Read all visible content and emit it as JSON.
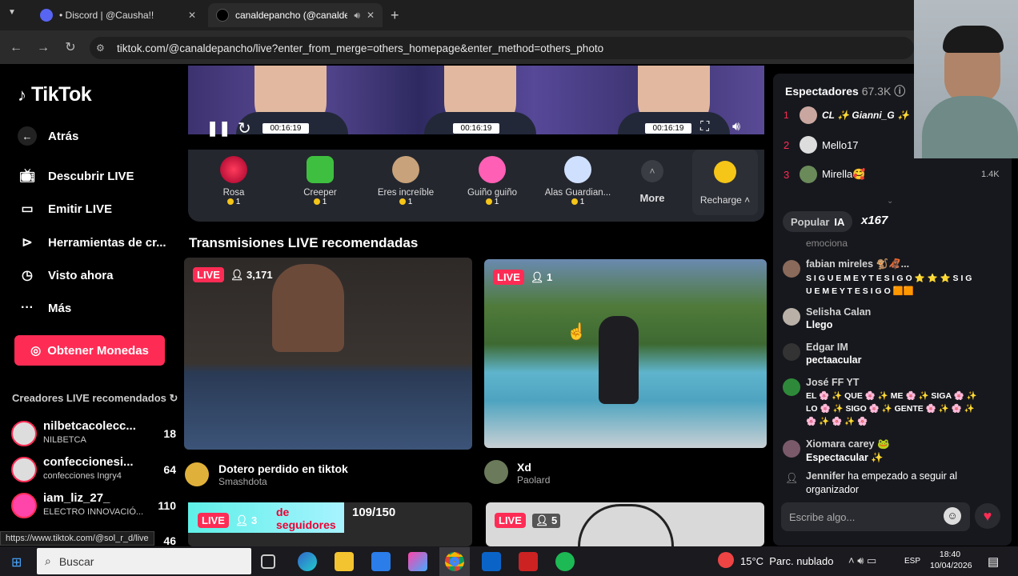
{
  "browser": {
    "tabs": [
      {
        "label": "• Discord | @Causha!!"
      },
      {
        "label": "canaldepancho (@canaldep"
      }
    ],
    "url": "tiktok.com/@canaldepancho/live?enter_from_merge=others_homepage&enter_method=others_photo"
  },
  "sidebar": {
    "logo": "TikTok",
    "back": "Atrás",
    "nav": [
      "Descubrir LIVE",
      "Emitir LIVE",
      "Herramientas de cr...",
      "Visto ahora",
      "Más"
    ],
    "coins_button": "Obtener Monedas",
    "creators_title": "Creadores LIVE recomendados",
    "creators": [
      {
        "name": "nilbetcacolecc...",
        "sub": "NILBETCA",
        "count": "18"
      },
      {
        "name": "confeccionesi...",
        "sub": "confecciones Ingry4",
        "count": "64"
      },
      {
        "name": "iam_liz_27_",
        "sub": "ELECTRO INNOVACIÓ...",
        "count": "110"
      },
      {
        "name": "",
        "sub": "",
        "count": "46"
      }
    ],
    "status_url": "https://www.tiktok.com/@sol_r_d/live"
  },
  "player": {
    "times": [
      "00:16:19",
      "00:16:19",
      "00:16:19"
    ]
  },
  "gifts": [
    {
      "name": "Rosa",
      "cost": "1"
    },
    {
      "name": "Creeper",
      "cost": "1"
    },
    {
      "name": "Eres increíble",
      "cost": "1"
    },
    {
      "name": "Guiño guiño",
      "cost": "1"
    },
    {
      "name": "Alas Guardian...",
      "cost": "1"
    }
  ],
  "gift_more": "More",
  "recharge": "Recharge",
  "recommended_title": "Transmisiones LIVE recomendadas",
  "streams": [
    {
      "badge": "LIVE",
      "viewers": "3,171",
      "title": "Dotero perdido en tiktok",
      "user": "Smashdota"
    },
    {
      "badge": "LIVE",
      "viewers": "1",
      "title": "Xd",
      "user": "Paolard"
    },
    {
      "badge": "LIVE",
      "viewers": "3",
      "progress_label": "109/150",
      "overlay": "de seguidores"
    },
    {
      "badge": "LIVE",
      "viewers": "5"
    }
  ],
  "chat": {
    "viewers_label": "Espectadores",
    "viewers_count": "67.3K",
    "top": [
      {
        "rank": "1",
        "name": "CL ✨ Gianni_G ✨"
      },
      {
        "rank": "2",
        "name": "Mello17"
      },
      {
        "rank": "3",
        "name": "Mirella🥰",
        "score": "1.4K"
      }
    ],
    "popular": "Popular",
    "ia": "IA",
    "multiplier": "x167",
    "partial": "emociona",
    "messages": [
      {
        "user": "fabian mireles 🐒🦧...",
        "text": "S I G U E M E Y T E S I G O ⭐ ⭐ ⭐ S I G",
        "text2": "U E M E Y T E S I G O 🟧🟧"
      },
      {
        "user": "Selisha Calan",
        "text": "Llego"
      },
      {
        "user": "Edgar IM",
        "text": "pectaacular"
      },
      {
        "user": "José FF YT",
        "text": "EL 🌸 ✨ QUE 🌸 ✨ ME 🌸 ✨ SIGA 🌸 ✨",
        "text2": "LO 🌸 ✨ SIGO 🌸 ✨ GENTE 🌸 ✨ 🌸 ✨",
        "text3": "🌸 ✨ 🌸 ✨ 🌸"
      },
      {
        "user": "Xiomara carey 🐸",
        "text": "Espectacular ✨"
      },
      {
        "user": "Jennifer",
        "text": "ha empezado a seguir al",
        "text2": "organizador"
      }
    ],
    "input_placeholder": "Escribe algo..."
  },
  "taskbar": {
    "search": "Buscar",
    "weather": "15°C  Parc. nublado",
    "lang": "ESP",
    "time": "18:40",
    "date": "10/04/2026"
  }
}
